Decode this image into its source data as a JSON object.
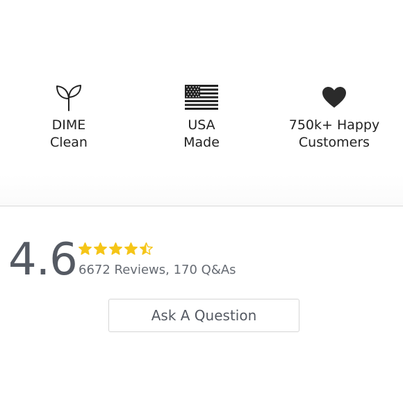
{
  "features": [
    {
      "icon": "leaf-sprout-icon",
      "line1": "DIME",
      "line2": "Clean"
    },
    {
      "icon": "us-flag-icon",
      "line1": "USA",
      "line2": "Made"
    },
    {
      "icon": "heart-icon",
      "line1": "750k+ Happy",
      "line2": "Customers"
    }
  ],
  "reviews": {
    "score": "4.6",
    "rating_value": 4.6,
    "rating_max": 5,
    "counts": "6672 Reviews, 170 Q&As",
    "star_color": "#f5c518"
  },
  "ask_button": {
    "label": "Ask A Question"
  }
}
